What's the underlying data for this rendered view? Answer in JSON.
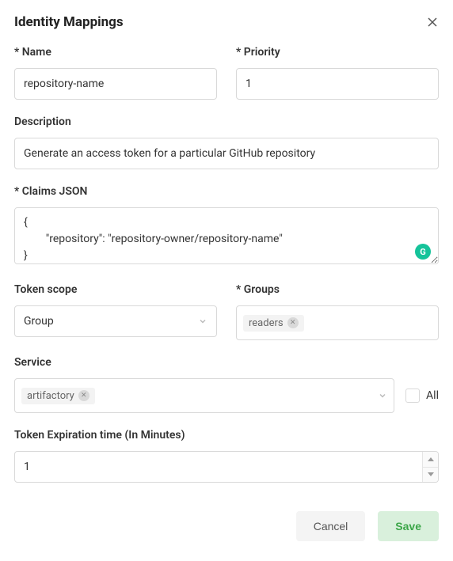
{
  "header": {
    "title": "Identity Mappings"
  },
  "fields": {
    "name_label": "* Name",
    "name_value": "repository-name",
    "priority_label": "* Priority",
    "priority_value": "1",
    "description_label": "Description",
    "description_value": "Generate an access token for a particular GitHub repository",
    "claims_label": "* Claims JSON",
    "claims_value": "{\n        \"repository\": \"repository-owner/repository-name\"\n}",
    "scope_label": "Token scope",
    "scope_value": "Group",
    "groups_label": "* Groups",
    "groups_tag": "readers",
    "service_label": "Service",
    "service_tag": "artifactory",
    "all_label": "All",
    "expiration_label": "Token Expiration time (In Minutes)",
    "expiration_value": "1"
  },
  "buttons": {
    "cancel": "Cancel",
    "save": "Save"
  }
}
